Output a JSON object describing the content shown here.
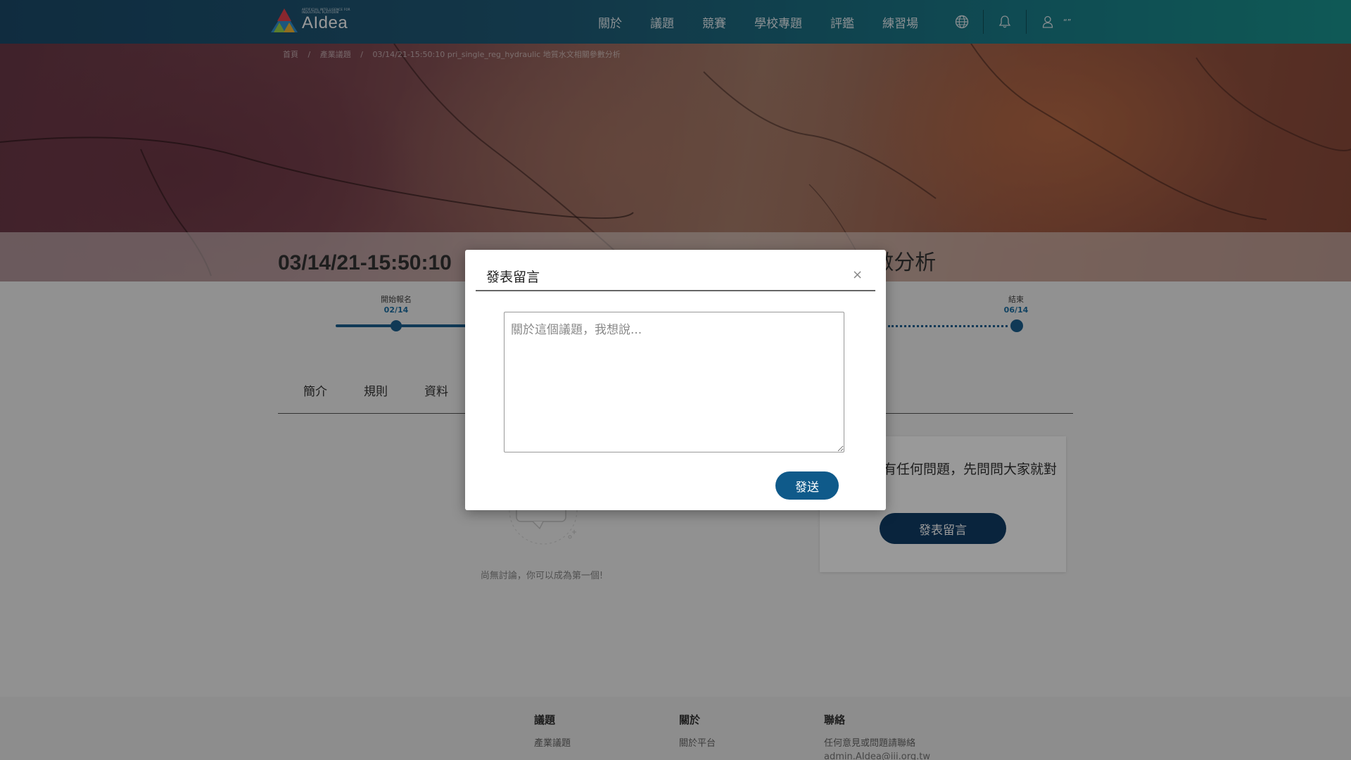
{
  "brand": {
    "logo_text": "AIdea",
    "logo_tagline": "ARTIFICIAL INTELLIGENCE FOR INDUSTRIAL PLATFORM"
  },
  "nav": {
    "links": [
      "關於",
      "議題",
      "競賽",
      "學校專題",
      "評鑑",
      "練習場"
    ],
    "user_name": "“”"
  },
  "breadcrumb": [
    "首頁",
    "/",
    "產業議題",
    "/",
    "03/14/21-15:50:10 pri_single_reg_hydraulic 地質水文相關參數分析"
  ],
  "page": {
    "title": "03/14/21-15:50:10",
    "title_right": "地質水文相關參數分析"
  },
  "timeline": {
    "start_label": "開始報名",
    "start_date": "02/14",
    "end_label": "結束",
    "end_date": "06/14"
  },
  "tabs": [
    "簡介",
    "規則",
    "資料"
  ],
  "discussion": {
    "empty_text": "尚無討論，你可以成為第一個!",
    "side_text": "有任何問題，先問問大家就對",
    "side_button": "發表留言"
  },
  "footer": {
    "col1": {
      "head": "議題",
      "item": "產業議題"
    },
    "col2": {
      "head": "關於",
      "item": "關於平台"
    },
    "col3": {
      "head": "聯絡",
      "item": "任何意見或問題請聯絡",
      "item2": "admin.AIdea@iii.org.tw"
    }
  },
  "modal": {
    "title": "發表留言",
    "close": "×",
    "placeholder": "關於這個議題，我想說...",
    "send": "發送"
  },
  "colors": {
    "nav_start": "#1b4a6a",
    "nav_end": "#19958f",
    "primary": "#0f5a8a",
    "dark_button": "#0f3d66"
  }
}
